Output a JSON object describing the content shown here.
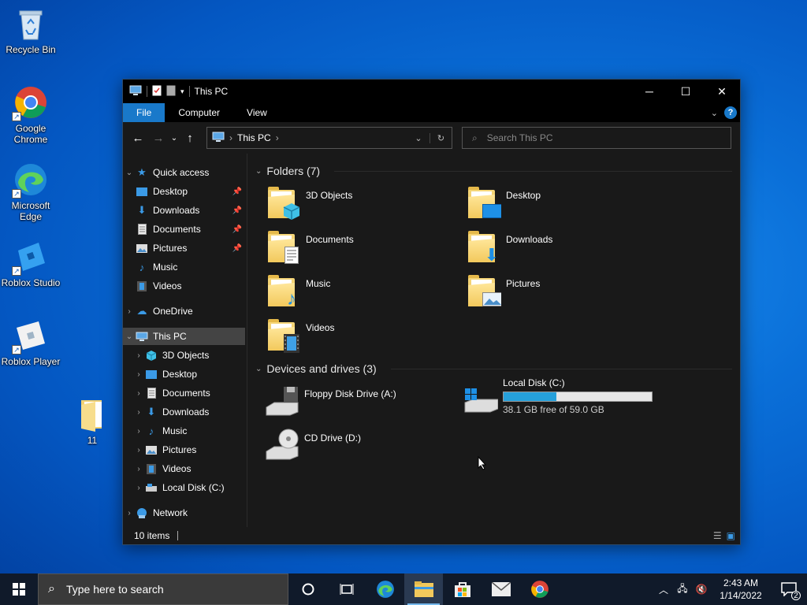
{
  "desktop": {
    "icons": [
      {
        "label": "Recycle Bin",
        "icon": "recycle-bin-icon"
      },
      {
        "label": "Google Chrome",
        "icon": "chrome-icon"
      },
      {
        "label": "Microsoft Edge",
        "icon": "edge-icon"
      },
      {
        "label": "Roblox Studio",
        "icon": "roblox-studio-icon"
      },
      {
        "label": "Roblox Player",
        "icon": "roblox-player-icon"
      },
      {
        "label": "11",
        "icon": "folder-icon"
      }
    ]
  },
  "window": {
    "title": "This PC",
    "controls": {
      "minimize": "─",
      "maximize": "☐",
      "close": "✕"
    },
    "ribbon_tabs": [
      "File",
      "Computer",
      "View"
    ],
    "help": "?",
    "address": {
      "crumb": "This PC",
      "sep": "›"
    },
    "search_placeholder": "Search This PC",
    "nav": {
      "quick_access": "Quick access",
      "quick_items": [
        "Desktop",
        "Downloads",
        "Documents",
        "Pictures",
        "Music",
        "Videos"
      ],
      "onedrive": "OneDrive",
      "this_pc": "This PC",
      "pc_items": [
        "3D Objects",
        "Desktop",
        "Documents",
        "Downloads",
        "Music",
        "Pictures",
        "Videos",
        "Local Disk (C:)"
      ],
      "network": "Network"
    },
    "folders_header": "Folders (7)",
    "folders": [
      "3D Objects",
      "Desktop",
      "Documents",
      "Downloads",
      "Music",
      "Pictures",
      "Videos"
    ],
    "devices_header": "Devices and drives (3)",
    "drives": {
      "floppy": "Floppy Disk Drive (A:)",
      "cd": "CD Drive (D:)",
      "local": "Local Disk (C:)",
      "local_free": "38.1 GB free of 59.0 GB",
      "local_used_fraction": 0.354
    },
    "status": "10 items"
  },
  "taskbar": {
    "search_placeholder": "Type here to search",
    "time": "2:43 AM",
    "date": "1/14/2022",
    "notifications": "2"
  },
  "colors": {
    "accent": "#1979ca",
    "dark_bg": "#191919",
    "drive_fill": "#26a0da"
  }
}
